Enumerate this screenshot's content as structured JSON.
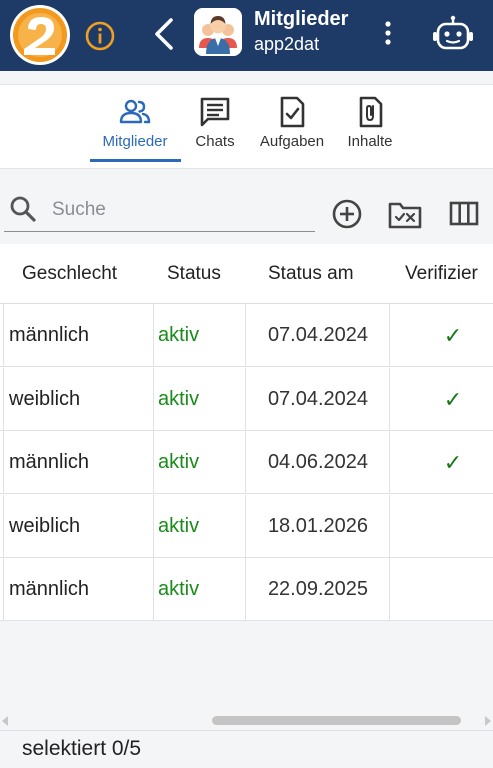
{
  "header": {
    "title": "Mitglieder",
    "subtitle": "app2dat",
    "bg_color": "#1e3a66",
    "info_color": "#f0a020"
  },
  "tabs": [
    {
      "label": "Mitglieder",
      "icon": "people-icon",
      "active": true
    },
    {
      "label": "Chats",
      "icon": "chat-icon",
      "active": false
    },
    {
      "label": "Aufgaben",
      "icon": "task-icon",
      "active": false
    },
    {
      "label": "Inhalte",
      "icon": "attachment-icon",
      "active": false
    }
  ],
  "search": {
    "placeholder": "Suche",
    "value": ""
  },
  "table": {
    "columns": [
      "Geschlecht",
      "Status",
      "Status am",
      "Verifizier"
    ],
    "rows": [
      {
        "gender": "männlich",
        "status": "aktiv",
        "status_date": "07.04.2024",
        "verified": "✓"
      },
      {
        "gender": "weiblich",
        "status": "aktiv",
        "status_date": "07.04.2024",
        "verified": "✓"
      },
      {
        "gender": "männlich",
        "status": "aktiv",
        "status_date": "04.06.2024",
        "verified": "✓"
      },
      {
        "gender": "weiblich",
        "status": "aktiv",
        "status_date": "18.01.2026",
        "verified": ""
      },
      {
        "gender": "männlich",
        "status": "aktiv",
        "status_date": "22.09.2025",
        "verified": ""
      }
    ]
  },
  "footer": {
    "selection": "selektiert 0/5"
  },
  "colors": {
    "accent": "#2a6ab9",
    "status_active": "#1a8a1a",
    "check": "#1a7a1a"
  }
}
